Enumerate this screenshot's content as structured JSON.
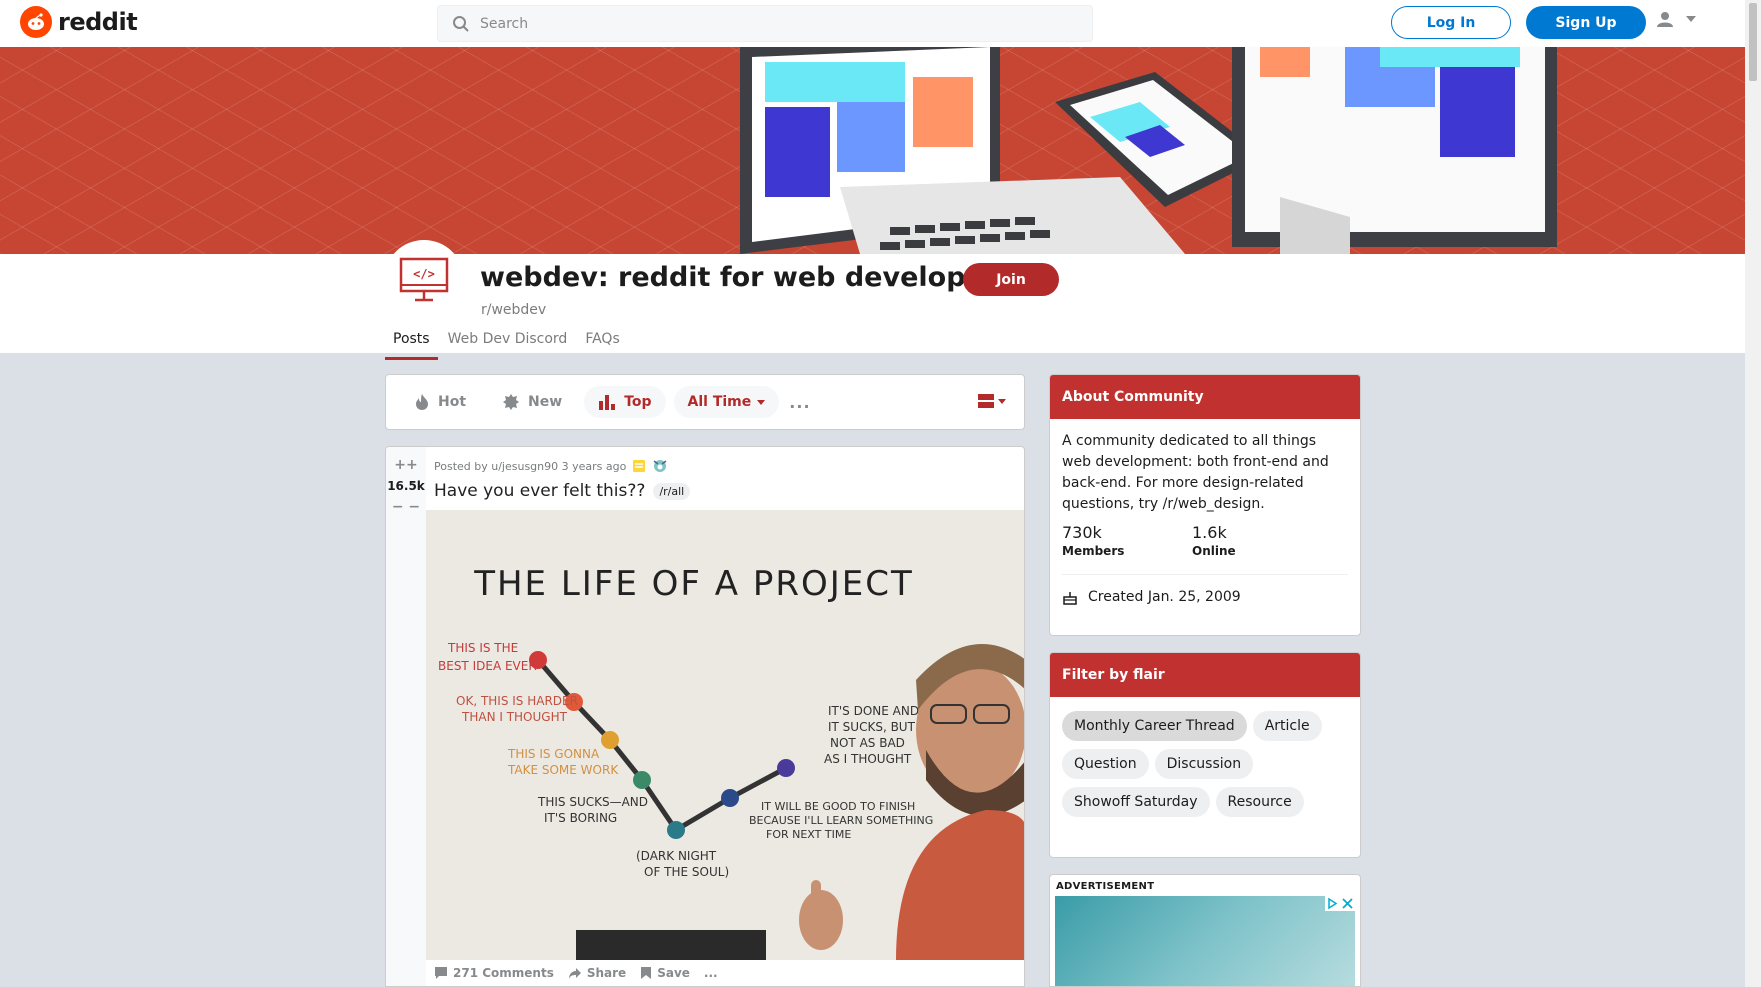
{
  "header": {
    "logo_text": "reddit",
    "search_placeholder": "Search",
    "login_label": "Log In",
    "signup_label": "Sign Up"
  },
  "subreddit": {
    "title": "webdev: reddit for web developers",
    "name": "r/webdev",
    "join_label": "Join",
    "tabs": [
      {
        "label": "Posts",
        "active": true
      },
      {
        "label": "Web Dev Discord",
        "active": false
      },
      {
        "label": "FAQs",
        "active": false
      }
    ],
    "accent_color": "#b32a2a"
  },
  "sort": {
    "hot": "Hot",
    "new": "New",
    "top": "Top",
    "time": "All Time",
    "more": "..."
  },
  "post": {
    "votes": "16.5k",
    "meta": "Posted by u/jesusgn90 3 years ago",
    "title": "Have you ever felt this??",
    "flair": "/r/all",
    "image": {
      "heading": "THE LIFE OF A PROJECT",
      "notes": [
        "THIS IS THE",
        "BEST IDEA EVER",
        "OK, THIS IS HARDER",
        "THAN I THOUGHT",
        "THIS IS GONNA",
        "TAKE SOME WORK",
        "THIS SUCKS—AND",
        "IT'S BORING",
        "(DARK NIGHT",
        "OF THE SOUL)",
        "IT WILL BE GOOD TO FINISH",
        "BECAUSE I'LL LEARN SOMETHING",
        "FOR NEXT TIME",
        "IT'S DONE AND",
        "IT SUCKS, BUT",
        "NOT AS BAD",
        "AS I THOUGHT"
      ]
    },
    "comments_label": "271 Comments",
    "share_label": "Share",
    "save_label": "Save",
    "more": "..."
  },
  "about": {
    "header": "About Community",
    "description": "A community dedicated to all things web development: both front-end and back-end. For more design-related questions, try /r/web_design.",
    "members_count": "730k",
    "members_label": "Members",
    "online_count": "1.6k",
    "online_label": "Online",
    "created": "Created Jan. 25, 2009"
  },
  "filter": {
    "header": "Filter by flair",
    "flairs": [
      "Monthly Career Thread",
      "Article",
      "Question",
      "Discussion",
      "Showoff Saturday",
      "Resource"
    ]
  },
  "ad": {
    "label": "ADVERTISEMENT"
  }
}
